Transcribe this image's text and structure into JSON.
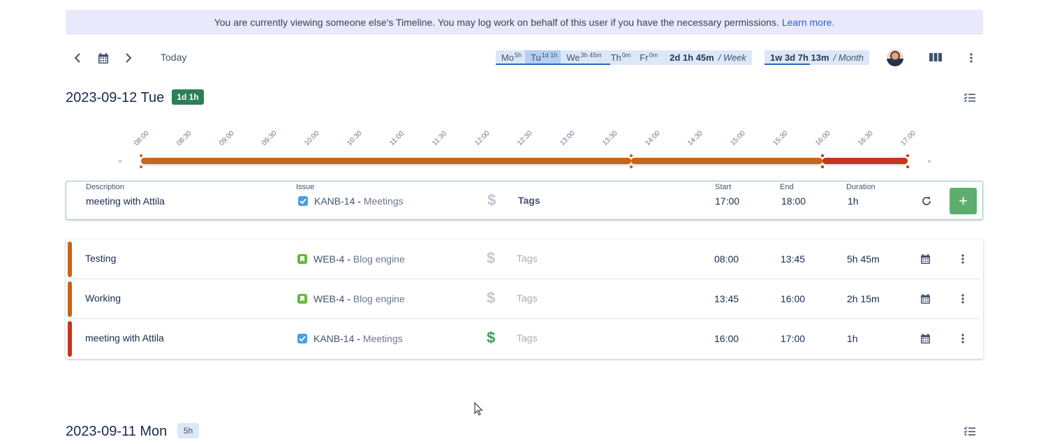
{
  "banner": {
    "text": "You are currently viewing someone else's Timeline. You may log work on behalf of this user if you have the necessary permissions.",
    "link": "Learn more."
  },
  "toolbar": {
    "prev_icon": "chevron-left-icon",
    "calendar_icon": "calendar-icon",
    "next_icon": "chevron-right-icon",
    "today_label": "Today",
    "week": {
      "days": [
        {
          "label": "Mo",
          "value": "5h"
        },
        {
          "label": "Tu",
          "value": "1d 1h"
        },
        {
          "label": "We",
          "value": "3h 45m"
        },
        {
          "label": "Th",
          "value": "0m"
        },
        {
          "label": "Fr",
          "value": "0m"
        }
      ],
      "total": "2d 1h 45m",
      "per": "/ Week",
      "progress": 0.6
    },
    "month": {
      "total": "1w 3d 7h 13m",
      "per": "/ Month",
      "progress": 0.44
    },
    "board_icon": "columns-icon",
    "more_icon": "more-vertical-icon"
  },
  "day1": {
    "title": "2023-09-12 Tue",
    "badge": "1d 1h",
    "badge_color": "#2e7d5b",
    "checklist_icon": "checklist-icon",
    "timeline": {
      "ticks": [
        "08:00",
        "08:30",
        "09:00",
        "09:30",
        "10:00",
        "10:30",
        "11:00",
        "11:30",
        "12:00",
        "12:30",
        "13:00",
        "13:30",
        "14:00",
        "14:30",
        "15:00",
        "15:30",
        "16:00",
        "16:30",
        "17:00"
      ],
      "segments": [
        {
          "start": "08:00",
          "end": "13:45",
          "color": "#c8651b"
        },
        {
          "start": "13:45",
          "end": "16:00",
          "color": "#c8651b"
        },
        {
          "start": "16:00",
          "end": "17:00",
          "color": "#c9341a"
        }
      ]
    },
    "editor": {
      "description_label": "Description",
      "description_value": "meeting with Attila",
      "issue_label": "Issue",
      "issue_key": "KANB-14",
      "issue_summary": "Meetings",
      "tags_label": "Tags",
      "start_label": "Start",
      "start_value": "17:00",
      "end_label": "End",
      "end_value": "18:00",
      "duration_label": "Duration",
      "duration_value": "1h",
      "add_label": "+"
    },
    "worklogs": [
      {
        "description": "Testing",
        "issue_key": "WEB-4",
        "issue_summary": "Blog engine",
        "issue_type": "story",
        "billable": false,
        "tags": "Tags",
        "start": "08:00",
        "end": "13:45",
        "duration": "5h 45m",
        "color": "#c8651b"
      },
      {
        "description": "Working",
        "issue_key": "WEB-4",
        "issue_summary": "Blog engine",
        "issue_type": "story",
        "billable": false,
        "tags": "Tags",
        "start": "13:45",
        "end": "16:00",
        "duration": "2h 15m",
        "color": "#c8651b"
      },
      {
        "description": "meeting with Attila",
        "issue_key": "KANB-14",
        "issue_summary": "Meetings",
        "issue_type": "task",
        "billable": true,
        "tags": "Tags",
        "start": "16:00",
        "end": "17:00",
        "duration": "1h",
        "color": "#c9341a"
      }
    ]
  },
  "day2": {
    "title": "2023-09-11 Mon",
    "badge": "5h",
    "badge_color": "#dce8f7",
    "checklist_icon": "checklist-icon"
  }
}
